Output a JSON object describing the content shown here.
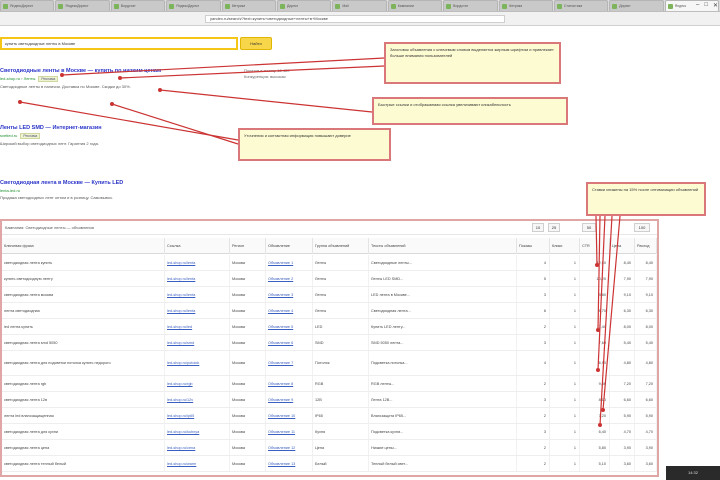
{
  "browser": {
    "tabs": [
      {
        "title": "ЯндексДирект"
      },
      {
        "title": "ЯндексДирект"
      },
      {
        "title": "Вордстат"
      },
      {
        "title": "ЯндексДирект"
      },
      {
        "title": "Метрика"
      },
      {
        "title": "Директ"
      },
      {
        "title": "Mail"
      },
      {
        "title": "Кампании"
      },
      {
        "title": "Вордстат"
      },
      {
        "title": "Метрика"
      },
      {
        "title": "Статистика"
      },
      {
        "title": "Директ"
      },
      {
        "title": "Яндекс"
      }
    ],
    "window_controls": {
      "minimize": "–",
      "maximize": "□",
      "close": "✕"
    },
    "url": "yandex.ru/search/?text=купить+светодиодные+ленты+в+Москве"
  },
  "search": {
    "query": "купить светодиодные ленты в Москве",
    "button_label": "Найти"
  },
  "results": [
    {
      "title": "Светодиодные ленты в Москве — купить по низким ценам",
      "url": "led-shop.ru › Ленты",
      "badge": "Реклама",
      "snippet": "Светодиодные ленты в наличии. Доставка по Москве. Скидки до 30%."
    },
    {
      "title": "Ленты LED SMD — Интернет-магазин",
      "url": "svetled.ru",
      "badge": "Реклама",
      "snippet": "Широкий выбор светодиодных лент. Гарантия 2 года."
    },
    {
      "title": "Светодиодная лента в Москве — Купить LED",
      "url": "lenta-led.ru",
      "badge": "",
      "snippet": "Продажа светодиодных лент оптом и в розницу. Самовывоз."
    }
  ],
  "side_info": [
    "Показов в месяц: 12 480",
    "Конкуренция: высокая"
  ],
  "callouts": [
    "Заголовок объявления с ключевым словом выделяется жирным шрифтом и привлекает больше внимания пользователей",
    "Быстрые ссылки и отображаемая ссылка увеличивают кликабельность",
    "Уточнения и контактная информация повышают доверие",
    "Ставки снижены на 15% после оптимизации объявлений"
  ],
  "table": {
    "breadcrumb": "Кампания: Светодиодные ленты — объявления",
    "controls": [
      "10",
      "25",
      "50",
      "100"
    ],
    "columns": [
      "Ключевая фраза",
      "Ссылка",
      "Регион",
      "Объявление",
      "Группа объявлений",
      "Тексты объявлений",
      "Показы",
      "Клики",
      "CTR",
      "Цена",
      "Расход"
    ],
    "rows": [
      {
        "phrase": "светодиодная лента купить",
        "link": "led-shop.ru/lenta",
        "region": "Москва",
        "ad": "Объявление 1",
        "group": "Ленты",
        "text": "Светодиодные ленты...",
        "shows": "4",
        "clicks": "1",
        "ctr": "12,50",
        "price": "8,40",
        "cost": "8,40"
      },
      {
        "phrase": "купить светодиодную ленту",
        "link": "led-shop.ru/lenta",
        "region": "Москва",
        "ad": "Объявление 2",
        "group": "Ленты",
        "text": "Ленты LED SMD...",
        "shows": "5",
        "clicks": "1",
        "ctr": "10,20",
        "price": "7,90",
        "cost": "7,90"
      },
      {
        "phrase": "светодиодная лента москва",
        "link": "led-shop.ru/lenta",
        "region": "Москва",
        "ad": "Объявление 3",
        "group": "Ленты",
        "text": "LED лента в Москве...",
        "shows": "3",
        "clicks": "1",
        "ctr": "9,80",
        "price": "9,10",
        "cost": "9,10"
      },
      {
        "phrase": "лента светодиодная",
        "link": "led-shop.ru/lenta",
        "region": "Москва",
        "ad": "Объявление 4",
        "group": "Ленты",
        "text": "Светодиодная лента...",
        "shows": "6",
        "clicks": "1",
        "ctr": "8,70",
        "price": "6,30",
        "cost": "6,30"
      },
      {
        "phrase": "led лента купить",
        "link": "led-shop.ru/led",
        "region": "Москва",
        "ad": "Объявление 5",
        "group": "LED",
        "text": "Купить LED ленту...",
        "shows": "2",
        "clicks": "1",
        "ctr": "11,40",
        "price": "8,00",
        "cost": "8,00"
      },
      {
        "phrase": "светодиодная лента smd 5050",
        "link": "led-shop.ru/smd",
        "region": "Москва",
        "ad": "Объявление 6",
        "group": "SMD",
        "text": "SMD 5050 лента...",
        "shows": "3",
        "clicks": "1",
        "ctr": "7,60",
        "price": "5,40",
        "cost": "5,40"
      },
      {
        "phrase": "светодиодная лента для подсветки потолка купить недорого",
        "link": "led-shop.ru/potolok",
        "region": "Москва",
        "ad": "Объявление 7",
        "group": "Потолок",
        "text": "Подсветка потолка...",
        "shows": "4",
        "clicks": "1",
        "ctr": "6,90",
        "price": "4,80",
        "cost": "4,80"
      },
      {
        "phrase": "светодиодная лента rgb",
        "link": "led-shop.ru/rgb",
        "region": "Москва",
        "ad": "Объявление 8",
        "group": "RGB",
        "text": "RGB ленты...",
        "shows": "2",
        "clicks": "1",
        "ctr": "9,30",
        "price": "7,20",
        "cost": "7,20"
      },
      {
        "phrase": "светодиодная лента 12в",
        "link": "led-shop.ru/12v",
        "region": "Москва",
        "ad": "Объявление 9",
        "group": "12В",
        "text": "Лента 12В...",
        "shows": "3",
        "clicks": "1",
        "ctr": "8,10",
        "price": "6,60",
        "cost": "6,60"
      },
      {
        "phrase": "лента led влагозащищенная",
        "link": "led-shop.ru/ip65",
        "region": "Москва",
        "ad": "Объявление 10",
        "group": "IP65",
        "text": "Влагозащита IP65...",
        "shows": "2",
        "clicks": "1",
        "ctr": "7,20",
        "price": "5,90",
        "cost": "5,90"
      },
      {
        "phrase": "светодиодная лента для кухни",
        "link": "led-shop.ru/kuhnya",
        "region": "Москва",
        "ad": "Объявление 11",
        "group": "Кухня",
        "text": "Подсветка кухни...",
        "shows": "3",
        "clicks": "1",
        "ctr": "6,40",
        "price": "4,70",
        "cost": "4,70"
      },
      {
        "phrase": "светодиодная лента цена",
        "link": "led-shop.ru/cena",
        "region": "Москва",
        "ad": "Объявление 12",
        "group": "Цена",
        "text": "Низкие цены...",
        "shows": "2",
        "clicks": "1",
        "ctr": "5,80",
        "price": "3,90",
        "cost": "3,90"
      },
      {
        "phrase": "светодиодная лента теплый белый",
        "link": "led-shop.ru/warm",
        "region": "Москва",
        "ad": "Объявление 13",
        "group": "Белый",
        "text": "Теплый белый свет...",
        "shows": "2",
        "clicks": "1",
        "ctr": "5,10",
        "price": "3,60",
        "cost": "3,60"
      }
    ]
  },
  "taskbar": {
    "clock": "14:32"
  }
}
